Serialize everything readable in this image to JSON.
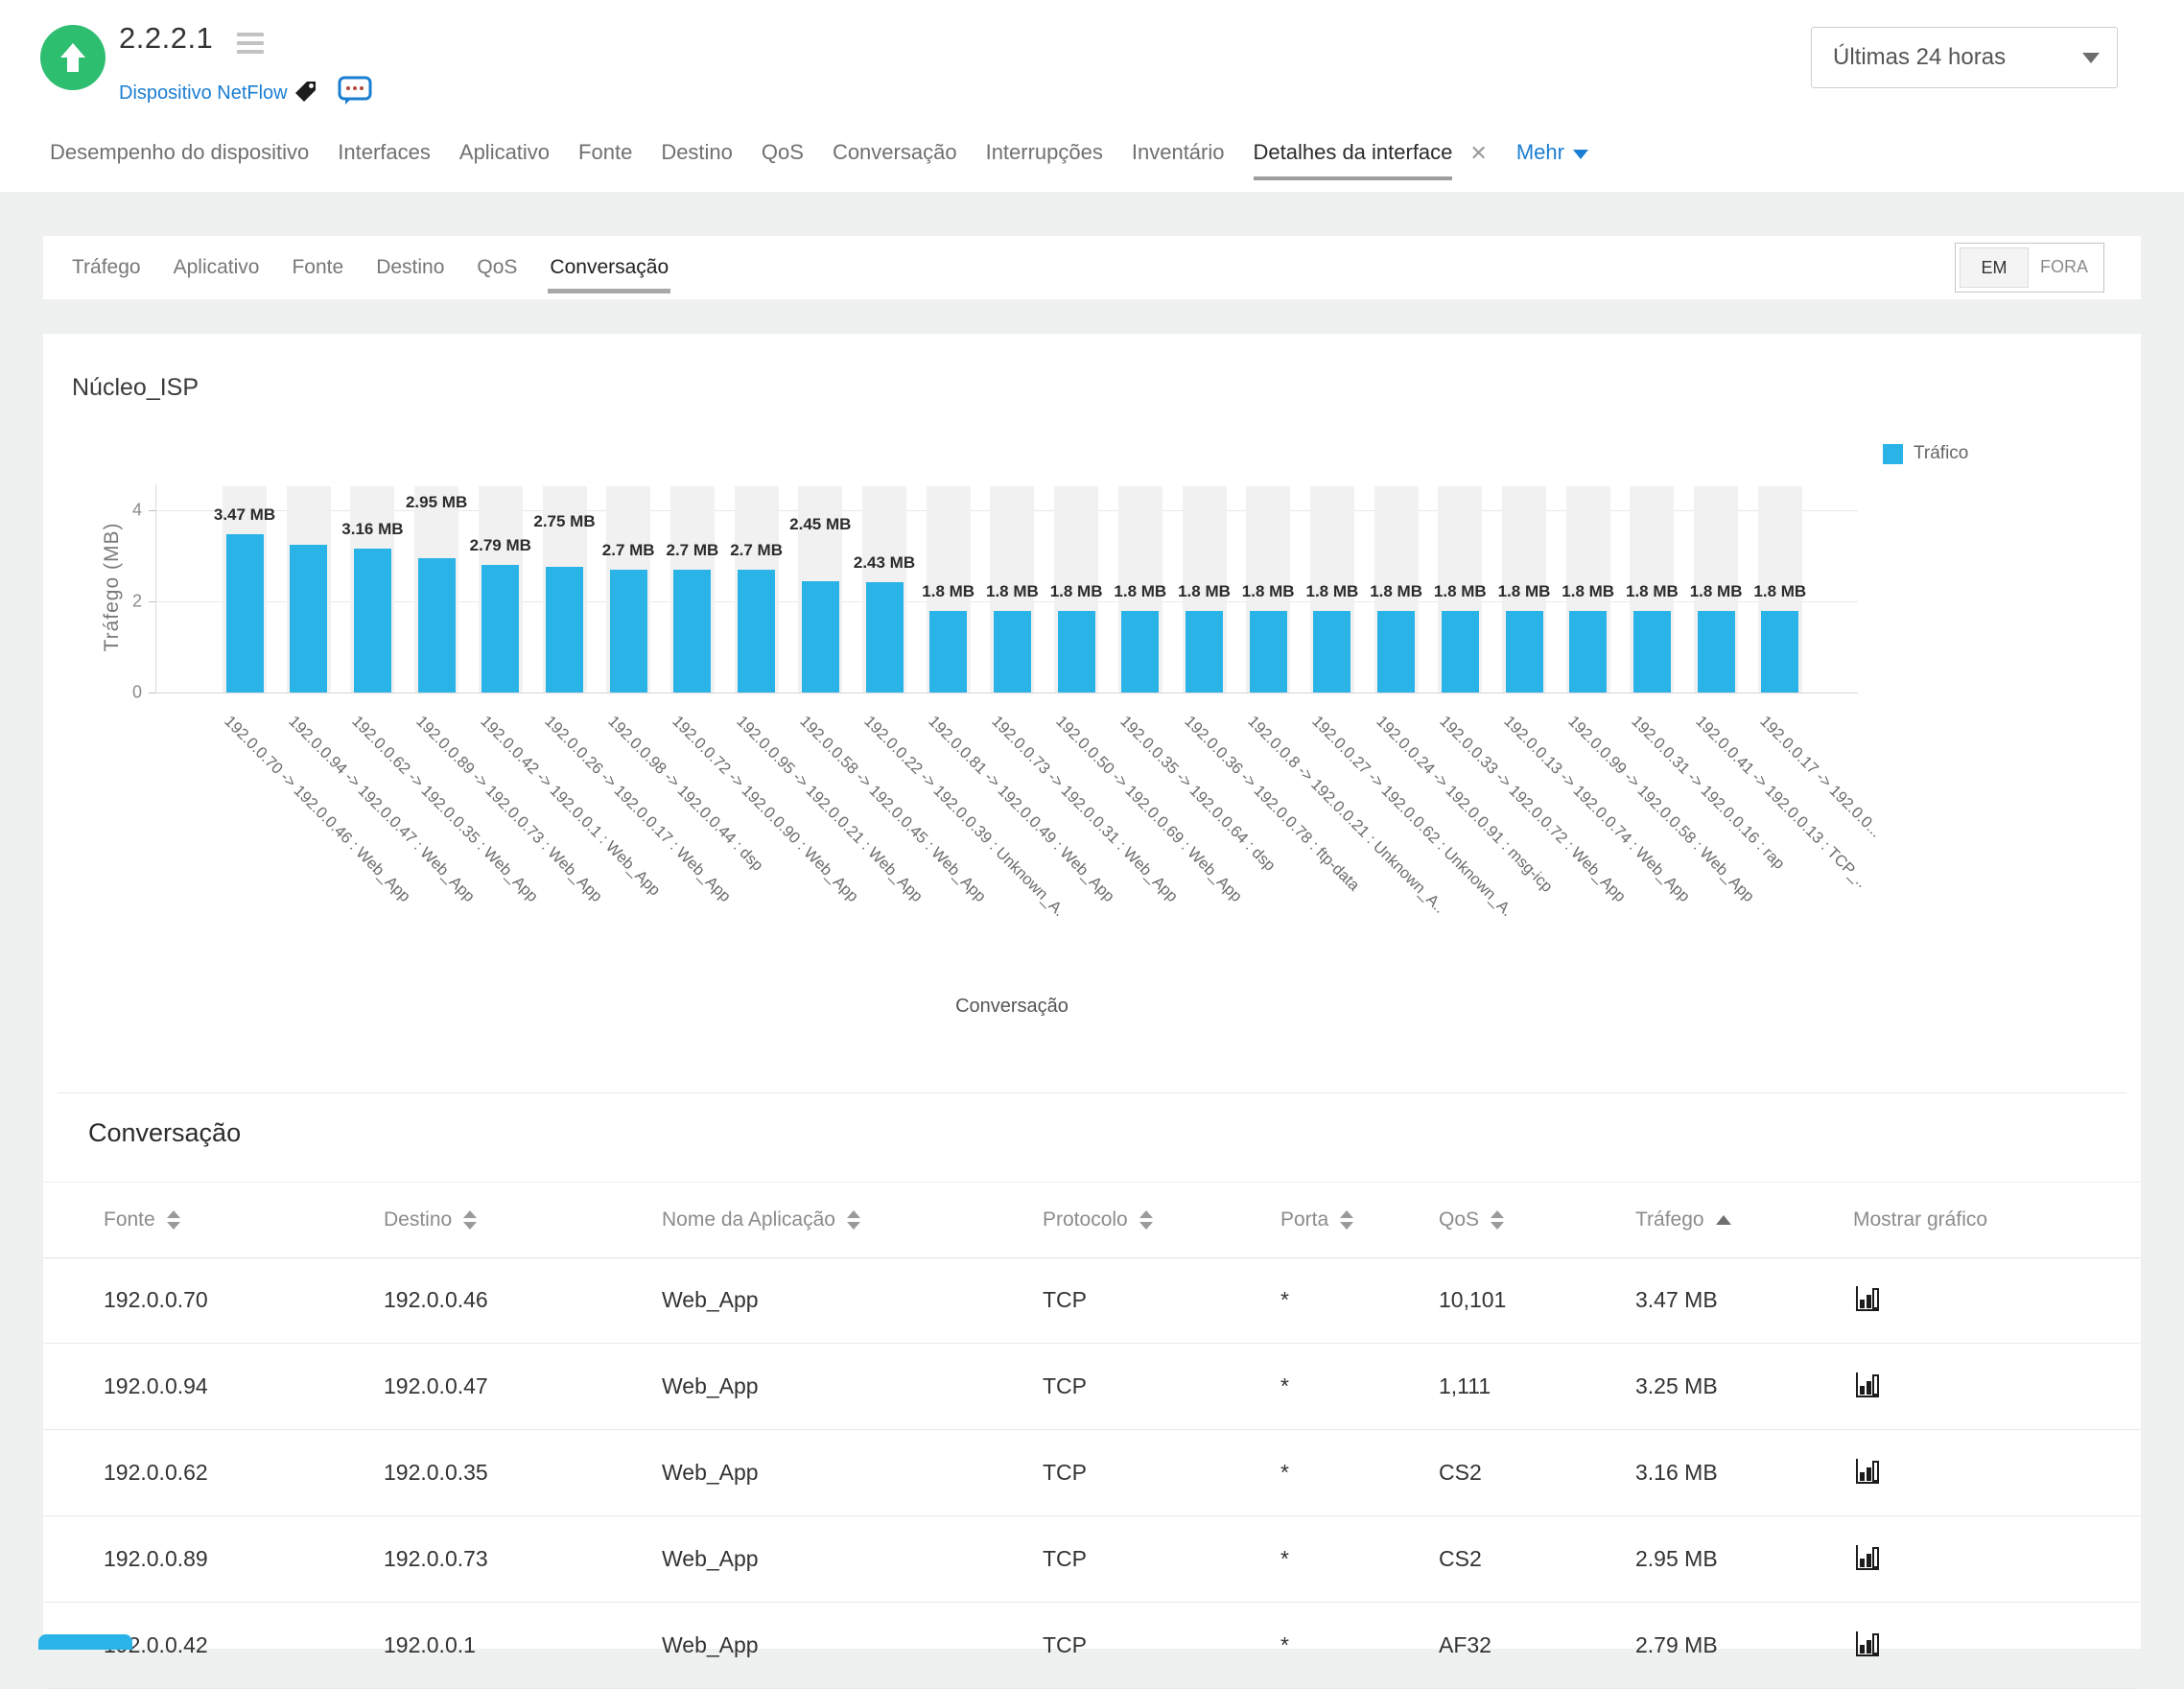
{
  "header": {
    "title": "2.2.2.1",
    "status": "up",
    "subtitle_link": "Dispositivo NetFlow",
    "time_range": "Últimas 24 horas",
    "nav_tabs": [
      {
        "label": "Desempenho do dispositivo",
        "active": false
      },
      {
        "label": "Interfaces",
        "active": false
      },
      {
        "label": "Aplicativo",
        "active": false
      },
      {
        "label": "Fonte",
        "active": false
      },
      {
        "label": "Destino",
        "active": false
      },
      {
        "label": "QoS",
        "active": false
      },
      {
        "label": "Conversação",
        "active": false
      },
      {
        "label": "Interrupções",
        "active": false
      },
      {
        "label": "Inventário",
        "active": false
      },
      {
        "label": "Detalhes da interface",
        "active": true,
        "closable": true
      }
    ],
    "mehr_label": "Mehr",
    "icons": [
      "up-arrow-icon",
      "hamburger-icon",
      "tag-icon",
      "comment-icon",
      "chevron-down-icon",
      "close-icon"
    ]
  },
  "subtabs": {
    "items": [
      {
        "label": "Tráfego",
        "active": false
      },
      {
        "label": "Aplicativo",
        "active": false
      },
      {
        "label": "Fonte",
        "active": false
      },
      {
        "label": "Destino",
        "active": false
      },
      {
        "label": "QoS",
        "active": false
      },
      {
        "label": "Conversação",
        "active": true
      }
    ],
    "toggle": {
      "in_label": "EM",
      "out_label": "FORA",
      "selected": "EM"
    }
  },
  "chart_data": {
    "type": "bar",
    "title": "Núcleo_ISP",
    "legend": [
      {
        "name": "Tráfico",
        "color": "#29b3e7"
      }
    ],
    "ylabel": "Tráfego (MB)",
    "xlabel": "Conversação",
    "yticks": [
      0,
      2,
      4
    ],
    "ylim": [
      0,
      4.6
    ],
    "bar_color": "#29b3e7",
    "grid": true,
    "categories": [
      "192.0.0.70 -> 192.0.0.46 : Web_App",
      "192.0.0.94 -> 192.0.0.47 : Web_App",
      "192.0.0.62 -> 192.0.0.35 : Web_App",
      "192.0.0.89 -> 192.0.0.73 : Web_App",
      "192.0.0.42 -> 192.0.0.1 : Web_App",
      "192.0.0.26 -> 192.0.0.17 : Web_App",
      "192.0.0.98 -> 192.0.0.44 : dsp",
      "192.0.0.72 -> 192.0.0.90 : Web_App",
      "192.0.0.95 -> 192.0.0.21 : Web_App",
      "192.0.0.58 -> 192.0.0.45 : Web_App",
      "192.0.0.22 -> 192.0.0.39 : Unknown_A.",
      "192.0.0.81 -> 192.0.0.49 : Web_App",
      "192.0.0.73 -> 192.0.0.31 : Web_App",
      "192.0.0.50 -> 192.0.0.69 : Web_App",
      "192.0.0.35 -> 192.0.0.64 : dsp",
      "192.0.0.36 -> 192.0.0.78 : ftp-data",
      "192.0.0.8 -> 192.0.0.21 : Unknown_A..",
      "192.0.0.27 -> 192.0.0.62 : Unknown_A.",
      "192.0.0.24 -> 192.0.0.91 : msg-icp",
      "192.0.0.33 -> 192.0.0.72 : Web_App",
      "192.0.0.13 -> 192.0.0.74 : Web_App",
      "192.0.0.99 -> 192.0.0.58 : Web_App",
      "192.0.0.31 -> 192.0.0.16 : rap",
      "192.0.0.41 -> 192.0.0.13 : TCP_..",
      "192.0.0.17 -> 192.0.0..."
    ],
    "values": [
      3.47,
      3.25,
      3.16,
      2.95,
      2.79,
      2.75,
      2.7,
      2.7,
      2.7,
      2.45,
      2.43,
      1.8,
      1.8,
      1.8,
      1.8,
      1.8,
      1.8,
      1.8,
      1.8,
      1.8,
      1.8,
      1.8,
      1.8,
      1.8,
      1.8
    ],
    "bar_labels": [
      "3.47 MB",
      "",
      "3.16 MB",
      "2.95 MB",
      "2.79 MB",
      "2.75 MB",
      "2.7 MB",
      "2.7 MB",
      "2.7 MB",
      "2.45 MB",
      "2.43 MB",
      "1.8 MB",
      "1.8 MB",
      "1.8 MB",
      "1.8 MB",
      "1.8 MB",
      "1.8 MB",
      "1.8 MB",
      "1.8 MB",
      "1.8 MB",
      "1.8 MB",
      "1.8 MB",
      "1.8 MB",
      "1.8 MB",
      "1.8 MB"
    ],
    "label_lifts": [
      9,
      0,
      9,
      47,
      9,
      36,
      9,
      9,
      9,
      48,
      9,
      9,
      9,
      9,
      9,
      9,
      9,
      9,
      9,
      9,
      9,
      9,
      9,
      9,
      9
    ]
  },
  "table": {
    "title": "Conversação",
    "columns": [
      {
        "label": "Fonte",
        "sort": "both"
      },
      {
        "label": "Destino",
        "sort": "both"
      },
      {
        "label": "Nome da Aplicação",
        "sort": "both"
      },
      {
        "label": "Protocolo",
        "sort": "both"
      },
      {
        "label": "Porta",
        "sort": "both"
      },
      {
        "label": "QoS",
        "sort": "both"
      },
      {
        "label": "Tráfego",
        "sort": "asc"
      },
      {
        "label": "Mostrar gráfico",
        "sort": null
      }
    ],
    "rows": [
      [
        "192.0.0.70",
        "192.0.0.46",
        "Web_App",
        "TCP",
        "*",
        "10,101",
        "3.47 MB"
      ],
      [
        "192.0.0.94",
        "192.0.0.47",
        "Web_App",
        "TCP",
        "*",
        "1,111",
        "3.25 MB"
      ],
      [
        "192.0.0.62",
        "192.0.0.35",
        "Web_App",
        "TCP",
        "*",
        "CS2",
        "3.16 MB"
      ],
      [
        "192.0.0.89",
        "192.0.0.73",
        "Web_App",
        "TCP",
        "*",
        "CS2",
        "2.95 MB"
      ],
      [
        "192.0.0.42",
        "192.0.0.1",
        "Web_App",
        "TCP",
        "*",
        "AF32",
        "2.79 MB"
      ]
    ],
    "row_icon": "bar-chart-icon"
  },
  "colors": {
    "accent_blue": "#29b3e7",
    "link_blue": "#1a7ed2",
    "status_green": "#2dbe70",
    "page_bg": "#eff1f1"
  }
}
